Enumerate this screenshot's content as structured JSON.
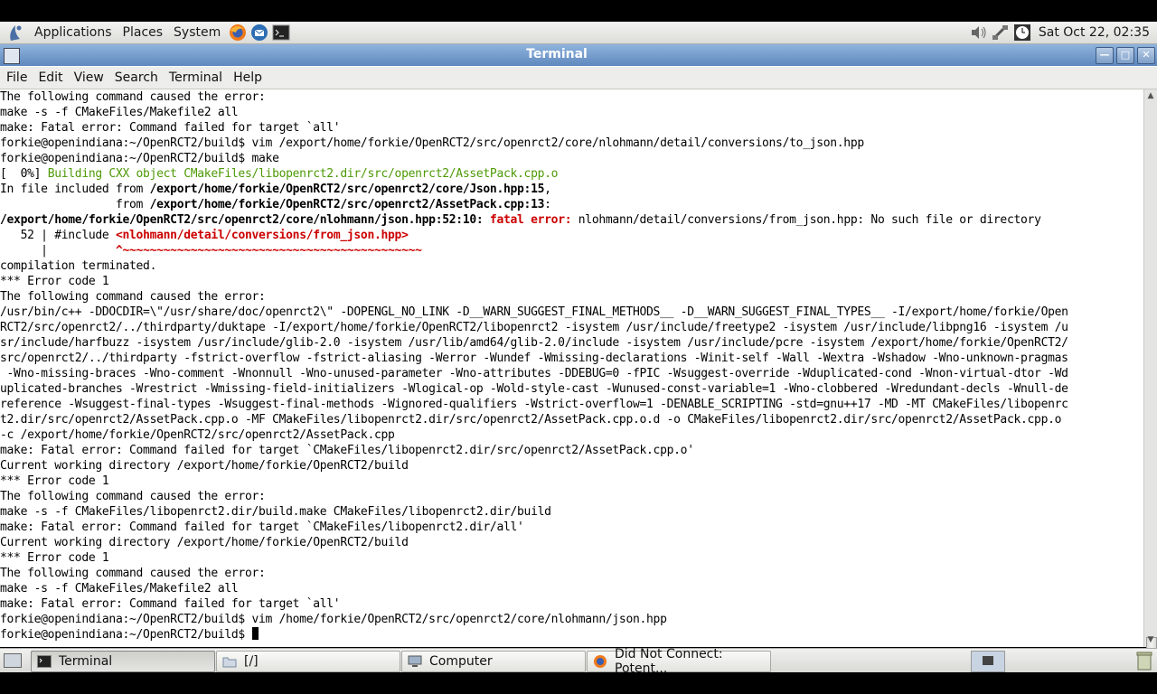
{
  "top_panel": {
    "menus": [
      "Applications",
      "Places",
      "System"
    ],
    "clock": "Sat Oct 22, 02:35"
  },
  "window": {
    "title": "Terminal",
    "menus": [
      "File",
      "Edit",
      "View",
      "Search",
      "Terminal",
      "Help"
    ]
  },
  "terminal": {
    "lines": [
      "The following command caused the error:",
      "make -s -f CMakeFiles/Makefile2 all",
      "make: Fatal error: Command failed for target `all'",
      "forkie@openindiana:~/OpenRCT2/build$ vim /export/home/forkie/OpenRCT2/src/openrct2/core/nlohmann/detail/conversions/to_json.hpp",
      "forkie@openindiana:~/OpenRCT2/build$ make",
      {
        "a": "[  0%] ",
        "g": "Building CXX object CMakeFiles/libopenrct2.dir/src/openrct2/AssetPack.cpp.o"
      },
      {
        "a": "In file included from ",
        "b": "/export/home/forkie/OpenRCT2/src/openrct2/core/Json.hpp:15",
        "c": ","
      },
      {
        "a": "                 from ",
        "b": "/export/home/forkie/OpenRCT2/src/openrct2/AssetPack.cpp:13",
        "c": ":"
      },
      {
        "b": "/export/home/forkie/OpenRCT2/src/openrct2/core/nlohmann/json.hpp:52:10: ",
        "r": "fatal error: ",
        "c": "nlohmann/detail/conversions/from_json.hpp: No such file or directory"
      },
      {
        "a": "   52 | #include ",
        "r": "<nlohmann/detail/conversions/from_json.hpp>"
      },
      {
        "a": "      |          ",
        "r": "^~~~~~~~~~~~~~~~~~~~~~~~~~~~~~~~~~~~~~~~~~~~~"
      },
      "compilation terminated.",
      "*** Error code 1",
      "The following command caused the error:",
      "/usr/bin/c++ -DDOCDIR=\\\"/usr/share/doc/openrct2\\\" -DOPENGL_NO_LINK -D__WARN_SUGGEST_FINAL_METHODS__ -D__WARN_SUGGEST_FINAL_TYPES__ -I/export/home/forkie/Open",
      "RCT2/src/openrct2/../thirdparty/duktape -I/export/home/forkie/OpenRCT2/libopenrct2 -isystem /usr/include/freetype2 -isystem /usr/include/libpng16 -isystem /u",
      "sr/include/harfbuzz -isystem /usr/include/glib-2.0 -isystem /usr/lib/amd64/glib-2.0/include -isystem /usr/include/pcre -isystem /export/home/forkie/OpenRCT2/",
      "src/openrct2/../thirdparty -fstrict-overflow -fstrict-aliasing -Werror -Wundef -Wmissing-declarations -Winit-self -Wall -Wextra -Wshadow -Wno-unknown-pragmas",
      " -Wno-missing-braces -Wno-comment -Wnonnull -Wno-unused-parameter -Wno-attributes -DDEBUG=0 -fPIC -Wsuggest-override -Wduplicated-cond -Wnon-virtual-dtor -Wd",
      "uplicated-branches -Wrestrict -Wmissing-field-initializers -Wlogical-op -Wold-style-cast -Wunused-const-variable=1 -Wno-clobbered -Wredundant-decls -Wnull-de",
      "reference -Wsuggest-final-types -Wsuggest-final-methods -Wignored-qualifiers -Wstrict-overflow=1 -DENABLE_SCRIPTING -std=gnu++17 -MD -MT CMakeFiles/libopenrc",
      "t2.dir/src/openrct2/AssetPack.cpp.o -MF CMakeFiles/libopenrct2.dir/src/openrct2/AssetPack.cpp.o.d -o CMakeFiles/libopenrct2.dir/src/openrct2/AssetPack.cpp.o",
      "-c /export/home/forkie/OpenRCT2/src/openrct2/AssetPack.cpp",
      "make: Fatal error: Command failed for target `CMakeFiles/libopenrct2.dir/src/openrct2/AssetPack.cpp.o'",
      "Current working directory /export/home/forkie/OpenRCT2/build",
      "*** Error code 1",
      "The following command caused the error:",
      "make -s -f CMakeFiles/libopenrct2.dir/build.make CMakeFiles/libopenrct2.dir/build",
      "make: Fatal error: Command failed for target `CMakeFiles/libopenrct2.dir/all'",
      "Current working directory /export/home/forkie/OpenRCT2/build",
      "*** Error code 1",
      "The following command caused the error:",
      "make -s -f CMakeFiles/Makefile2 all",
      "make: Fatal error: Command failed for target `all'",
      "forkie@openindiana:~/OpenRCT2/build$ vim /home/forkie/OpenRCT2/src/openrct2/core/nlohmann/json.hpp"
    ],
    "prompt": "forkie@openindiana:~/OpenRCT2/build$ "
  },
  "taskbar": {
    "tasks": [
      "Terminal",
      "[/]",
      "Computer",
      "Did Not Connect: Potent..."
    ]
  },
  "colors": {
    "green": "#4e9a06",
    "red": "#cc0000",
    "titlebar": "#6f97c9"
  }
}
